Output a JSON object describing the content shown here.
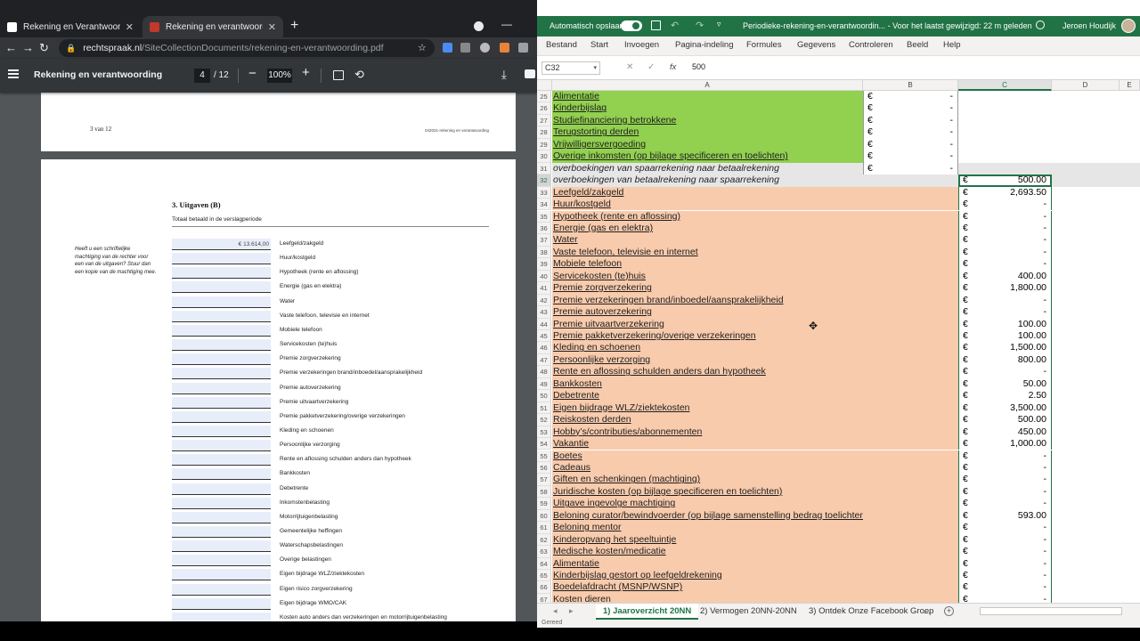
{
  "chrome": {
    "tabs": [
      {
        "label": "Rekening en Verantwoording Be",
        "favicon_color": "#ffffff"
      },
      {
        "label": "Rekening en verantwoording",
        "favicon_color": "#c0392b"
      }
    ],
    "url_host": "rechtspraak.nl",
    "url_path": "/SiteCollectionDocuments/rekening-en-verantwoording.pdf"
  },
  "pdf": {
    "title": "Rekening en verantwoording",
    "page_current": "4",
    "page_total": "/ 12",
    "zoom": "100%",
    "page_prev_number": "3 van 12",
    "page_prev_footer": "042021-rekening en verantwoording",
    "section_title": "3. Uitgaven (B)",
    "section_sub": "Totaal betaald in de verslagperiode",
    "side_note": "Heeft u een schriftelijke machtiging van de rechter voor een van de uitgaven? Stuur dan een kopie van de machtiging mee.",
    "expenses": [
      {
        "value": "€ 13.614,00",
        "label": "Leefgeld/zakgeld"
      },
      {
        "value": "",
        "label": "Huur/kostgeld"
      },
      {
        "value": "",
        "label": "Hypotheek (rente en aflossing)"
      },
      {
        "value": "",
        "label": "Energie (gas en elektra)"
      },
      {
        "value": "",
        "label": "Water"
      },
      {
        "value": "",
        "label": "Vaste telefoon, televisie en internet"
      },
      {
        "value": "",
        "label": "Mobiele telefoon"
      },
      {
        "value": "",
        "label": "Servicekosten (te)huis"
      },
      {
        "value": "",
        "label": "Premie zorgverzekering"
      },
      {
        "value": "",
        "label": "Premie verzekeringen brand/inboedel/aansprakelijkheid"
      },
      {
        "value": "",
        "label": "Premie autoverzekering"
      },
      {
        "value": "",
        "label": "Premie uitvaartverzekering"
      },
      {
        "value": "",
        "label": "Premie pakketverzekering/overige verzekeringen"
      },
      {
        "value": "",
        "label": "Kleding en schoenen"
      },
      {
        "value": "",
        "label": "Persoonlijke verzorging"
      },
      {
        "value": "",
        "label": "Rente en aflossing schulden anders dan hypotheek"
      },
      {
        "value": "",
        "label": "Bankkosten"
      },
      {
        "value": "",
        "label": "Debetrente"
      },
      {
        "value": "",
        "label": "Inkomstenbelasting"
      },
      {
        "value": "",
        "label": "Motorrijtuigenbelasting"
      },
      {
        "value": "",
        "label": "Gemeentelijke heffingen"
      },
      {
        "value": "",
        "label": "Waterschapsbelastingen"
      },
      {
        "value": "",
        "label": "Overige belastingen"
      },
      {
        "value": "",
        "label": "Eigen bijdrage WLZ/ziektekosten"
      },
      {
        "value": "",
        "label": "Eigen risico zorgverzekering"
      },
      {
        "value": "",
        "label": "Eigen bijdrage WMO/CAK"
      },
      {
        "value": "",
        "label": "Kosten auto anders dan verzekeringen en motorrijtuigenbelasting"
      }
    ]
  },
  "excel": {
    "autosave_label": "Automatisch opslaan",
    "doc_title": "Periodieke-rekening-en-verantwoordin...  -  Voor het laatst gewijzigd: 22 m geleden",
    "user_name": "Jeroen Houdijk",
    "ribbon_tabs": [
      "Bestand",
      "Start",
      "Invoegen",
      "Pagina-indeling",
      "Formules",
      "Gegevens",
      "Controleren",
      "Beeld",
      "Help"
    ],
    "name_box": "C32",
    "formula_value": "500",
    "columns": [
      "A",
      "B",
      "C",
      "D",
      "E"
    ],
    "currency": "€",
    "rows": [
      {
        "n": "25",
        "a": "Alimentatie",
        "b": "-",
        "c": null,
        "fill": "green",
        "u": true
      },
      {
        "n": "26",
        "a": "Kinderbijslag",
        "b": "-",
        "c": null,
        "fill": "green",
        "u": true
      },
      {
        "n": "27",
        "a": "Studiefinanciering betrokkene",
        "b": "-",
        "c": null,
        "fill": "green",
        "u": true
      },
      {
        "n": "28",
        "a": "Terugstorting derden",
        "b": "-",
        "c": null,
        "fill": "green",
        "u": true
      },
      {
        "n": "29",
        "a": "Vrijwilligersvergoeding",
        "b": "-",
        "c": null,
        "fill": "green",
        "u": true
      },
      {
        "n": "30",
        "a": "Overige inkomsten (op bijlage specificeren en toelichten)",
        "b": "-",
        "c": null,
        "fill": "green",
        "u": true
      },
      {
        "n": "31",
        "a": "overboekingen van spaarrekening naar betaalrekening",
        "b": "-",
        "c": null,
        "fill": "grey",
        "u": false,
        "i": true
      },
      {
        "n": "32",
        "a": "overboekingen van betaalrekening naar spaarrekening",
        "b": null,
        "c": "500.00",
        "fill": "grey",
        "u": false,
        "i": true
      },
      {
        "n": "33",
        "a": "Leefgeld/zakgeld",
        "b": null,
        "c": "2,693.50",
        "fill": "peach",
        "u": true
      },
      {
        "n": "34",
        "a": "Huur/kostgeld",
        "b": null,
        "c": "-",
        "fill": "peach",
        "u": true
      },
      {
        "n": "35",
        "a": "Hypotheek (rente en aflossing)",
        "b": null,
        "c": "-",
        "fill": "peach",
        "u": true
      },
      {
        "n": "36",
        "a": "Energie (gas en elektra)",
        "b": null,
        "c": "-",
        "fill": "peach",
        "u": true
      },
      {
        "n": "37",
        "a": "Water",
        "b": null,
        "c": "-",
        "fill": "peach",
        "u": true
      },
      {
        "n": "38",
        "a": "Vaste telefoon, televisie en internet",
        "b": null,
        "c": "-",
        "fill": "peach",
        "u": true
      },
      {
        "n": "39",
        "a": "Mobiele telefoon",
        "b": null,
        "c": "-",
        "fill": "peach",
        "u": true
      },
      {
        "n": "40",
        "a": "Servicekosten (te)huis",
        "b": null,
        "c": "400.00",
        "fill": "peach",
        "u": true
      },
      {
        "n": "41",
        "a": "Premie zorgverzekering",
        "b": null,
        "c": "1,800.00",
        "fill": "peach",
        "u": true
      },
      {
        "n": "42",
        "a": "Premie verzekeringen brand/inboedel/aansprakelijkheid",
        "b": null,
        "c": "-",
        "fill": "peach",
        "u": true
      },
      {
        "n": "43",
        "a": "Premie autoverzekering",
        "b": null,
        "c": "-",
        "fill": "peach",
        "u": true
      },
      {
        "n": "44",
        "a": "Premie uitvaartverzekering",
        "b": null,
        "c": "100.00",
        "fill": "peach",
        "u": true
      },
      {
        "n": "45",
        "a": "Premie pakketverzekering/overige verzekeringen",
        "b": null,
        "c": "100.00",
        "fill": "peach",
        "u": true
      },
      {
        "n": "46",
        "a": "Kleding en schoenen",
        "b": null,
        "c": "1,500.00",
        "fill": "peach",
        "u": true
      },
      {
        "n": "47",
        "a": "Persoonlijke verzorging",
        "b": null,
        "c": "800.00",
        "fill": "peach",
        "u": true
      },
      {
        "n": "48",
        "a": "Rente en aflossing schulden anders dan hypotheek",
        "b": null,
        "c": "-",
        "fill": "peach",
        "u": true
      },
      {
        "n": "49",
        "a": "Bankkosten",
        "b": null,
        "c": "50.00",
        "fill": "peach",
        "u": true
      },
      {
        "n": "50",
        "a": "Debetrente",
        "b": null,
        "c": "2.50",
        "fill": "peach",
        "u": true
      },
      {
        "n": "51",
        "a": "Eigen bijdrage WLZ/ziektekosten",
        "b": null,
        "c": "3,500.00",
        "fill": "peach",
        "u": true
      },
      {
        "n": "52",
        "a": "Reiskosten derden",
        "b": null,
        "c": "500.00",
        "fill": "peach",
        "u": true
      },
      {
        "n": "53",
        "a": "Hobby’s/contributies/abonnementen",
        "b": null,
        "c": "450.00",
        "fill": "peach",
        "u": true
      },
      {
        "n": "54",
        "a": "Vakantie",
        "b": null,
        "c": "1,000.00",
        "fill": "peach",
        "u": true
      },
      {
        "n": "55",
        "a": "Boetes",
        "b": null,
        "c": "-",
        "fill": "peach",
        "u": true
      },
      {
        "n": "56",
        "a": "Cadeaus ",
        "b": null,
        "c": "-",
        "fill": "peach",
        "u": true
      },
      {
        "n": "57",
        "a": "Giften en schenkingen (machtiging) ",
        "b": null,
        "c": "-",
        "fill": "peach",
        "u": true
      },
      {
        "n": "58",
        "a": "Juridische kosten (op bijlage specificeren en toelichten)",
        "b": null,
        "c": "-",
        "fill": "peach",
        "u": true
      },
      {
        "n": "59",
        "a": "Uitgave ingevolge machtiging",
        "b": null,
        "c": "-",
        "fill": "peach",
        "u": true
      },
      {
        "n": "60",
        "a": "Beloning curator/bewindvoerder (op bijlage samenstelling bedrag toelichten)",
        "b": null,
        "c": "593.00",
        "fill": "peach",
        "u": true
      },
      {
        "n": "61",
        "a": "Beloning mentor",
        "b": null,
        "c": "-",
        "fill": "peach",
        "u": true
      },
      {
        "n": "62",
        "a": "Kinderopvang het speeltuintje",
        "b": null,
        "c": "-",
        "fill": "peach",
        "u": true
      },
      {
        "n": "63",
        "a": "Medische kosten/medicatie    ",
        "b": null,
        "c": "-",
        "fill": "peach",
        "u": true
      },
      {
        "n": "64",
        "a": "Alimentatie",
        "b": null,
        "c": "-",
        "fill": "peach",
        "u": true
      },
      {
        "n": "65",
        "a": "Kinderbijslag gestort op leefgeldrekening",
        "b": null,
        "c": "-",
        "fill": "peach",
        "u": true
      },
      {
        "n": "66",
        "a": "Boedelafdracht (MSNP/WSNP)",
        "b": null,
        "c": "-",
        "fill": "peach",
        "u": true
      },
      {
        "n": "67",
        "a": "Kosten dieren",
        "b": null,
        "c": "-",
        "fill": "peach",
        "u": true
      }
    ],
    "sheet_tabs": [
      "1) Jaaroverzicht 20NN",
      "2) Vermogen 20NN-20NN",
      "3) Ontdek Onze Facebook Groep",
      "..."
    ],
    "status": "Gereed"
  },
  "colors": {
    "excel_green": "#217346",
    "income_fill": "#92d050",
    "expense_fill": "#f8cbad"
  }
}
